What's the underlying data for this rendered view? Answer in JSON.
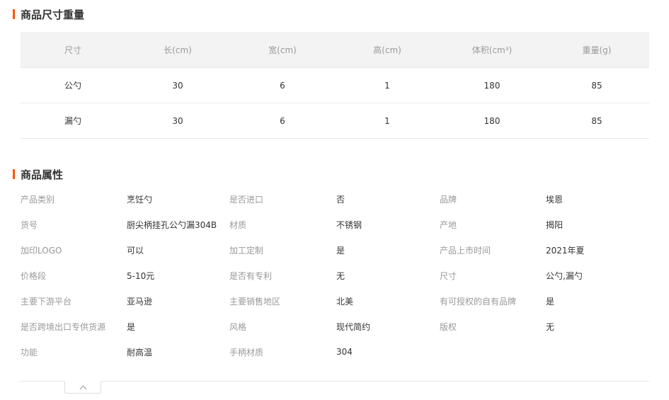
{
  "size_section": {
    "title": "商品尺寸重量",
    "headers": [
      "尺寸",
      "长(cm)",
      "宽(cm)",
      "高(cm)",
      "体积(cm³)",
      "重量(g)"
    ],
    "rows": [
      [
        "公勺",
        "30",
        "6",
        "1",
        "180",
        "85"
      ],
      [
        "漏勺",
        "30",
        "6",
        "1",
        "180",
        "85"
      ]
    ]
  },
  "attr_section": {
    "title": "商品属性",
    "rows": [
      [
        [
          "产品类别",
          "烹饪勺"
        ],
        [
          "是否进口",
          "否"
        ],
        [
          "品牌",
          "埃恩"
        ]
      ],
      [
        [
          "货号",
          "厨尖柄挂孔公勺漏304B"
        ],
        [
          "材质",
          "不锈钢"
        ],
        [
          "产地",
          "揭阳"
        ]
      ],
      [
        [
          "加印LOGO",
          "可以"
        ],
        [
          "加工定制",
          "是"
        ],
        [
          "产品上市时间",
          "2021年夏"
        ]
      ],
      [
        [
          "价格段",
          "5-10元"
        ],
        [
          "是否有专利",
          "无"
        ],
        [
          "尺寸",
          "公勺,漏勺"
        ]
      ],
      [
        [
          "主要下游平台",
          "亚马逊"
        ],
        [
          "主要销售地区",
          "北美"
        ],
        [
          "有可授权的自有品牌",
          "是"
        ]
      ],
      [
        [
          "是否跨境出口专供货源",
          "是"
        ],
        [
          "风格",
          "现代简约"
        ],
        [
          "版权",
          "无"
        ]
      ],
      [
        [
          "功能",
          "耐高温"
        ],
        [
          "手柄材质",
          "304"
        ],
        [
          "",
          ""
        ]
      ]
    ]
  },
  "collapse": {
    "icon": "chevron-up-icon"
  },
  "colors": {
    "accent": "#ff5500",
    "header_bg": "#f3f3f3",
    "label": "#999999"
  }
}
